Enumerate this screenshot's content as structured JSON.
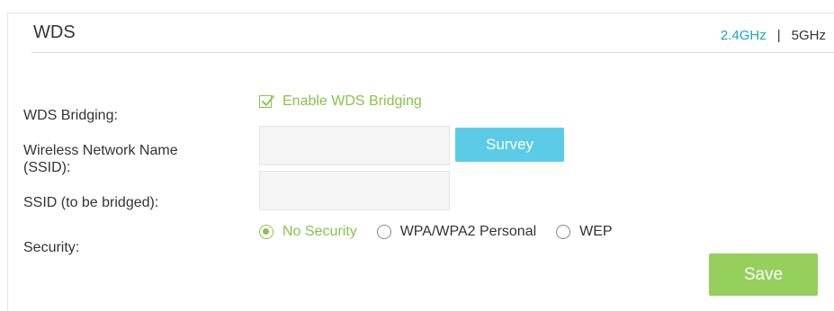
{
  "header": {
    "title": "WDS",
    "band_active": "2.4GHz",
    "band_separator": "|",
    "band_inactive": "5GHz"
  },
  "form": {
    "bridging_label": "WDS Bridging:",
    "bridging_checkbox_label": "Enable WDS Bridging",
    "bridging_checked": true,
    "ssid_label_line1": "Wireless Network Name",
    "ssid_label_line2": "(SSID):",
    "ssid_value": "",
    "survey_label": "Survey",
    "bridged_label": "SSID (to be bridged):",
    "bridged_value": "",
    "security_label": "Security:",
    "security_options": [
      "No Security",
      "WPA/WPA2 Personal",
      "WEP"
    ],
    "security_selected": "No Security"
  },
  "actions": {
    "save_label": "Save"
  },
  "colors": {
    "accent_green": "#8ac24a",
    "save_green": "#94d05b",
    "survey_blue": "#5bcbe8",
    "band_blue": "#1aa4c3"
  }
}
